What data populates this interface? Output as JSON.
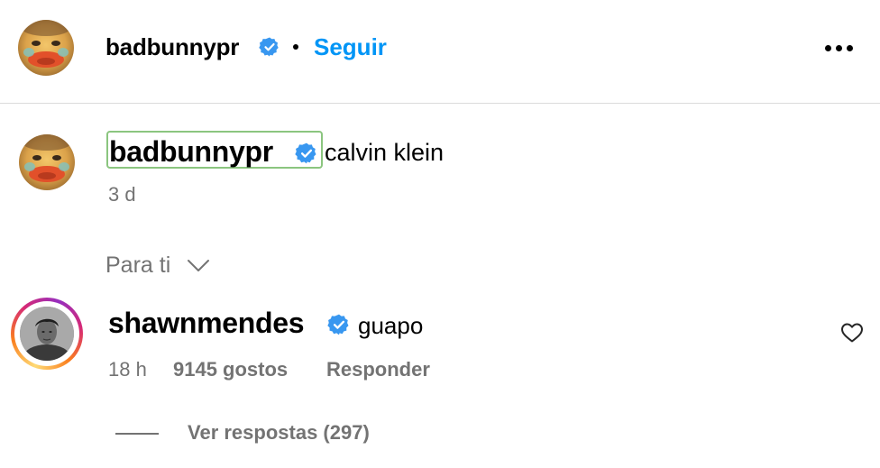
{
  "colors": {
    "accent": "#0095f6",
    "verified": "#3897f0",
    "muted": "#737373",
    "divider": "#dbdbdb",
    "highlight_border": "#8bc57f"
  },
  "header": {
    "username": "badbunnypr",
    "separator": "•",
    "follow_label": "Seguir",
    "more_icon": "more-horizontal-icon"
  },
  "caption": {
    "username": "badbunnypr",
    "text": "calvin klein",
    "time": "3 d"
  },
  "sort": {
    "label": "Para ti",
    "icon": "chevron-down-icon"
  },
  "comment": {
    "username": "shawnmendes",
    "text": "guapo",
    "time": "18 h",
    "likes": "9145 gostos",
    "reply_label": "Responder",
    "like_icon": "heart-outline-icon"
  },
  "replies": {
    "label": "Ver respostas (297)"
  }
}
